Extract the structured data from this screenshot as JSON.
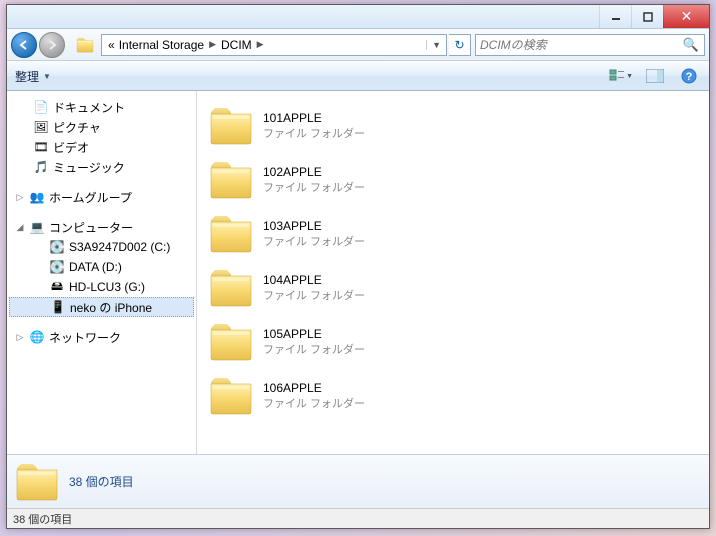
{
  "breadcrumb": {
    "root_marker": "«",
    "seg1": "Internal Storage",
    "seg2": "DCIM"
  },
  "search": {
    "placeholder": "DCIMの検索"
  },
  "toolbar": {
    "organize": "整理"
  },
  "tree": {
    "libraries": [
      {
        "label": "ドキュメント"
      },
      {
        "label": "ピクチャ"
      },
      {
        "label": "ビデオ"
      },
      {
        "label": "ミュージック"
      }
    ],
    "homegroup": "ホームグループ",
    "computer": "コンピューター",
    "drives": [
      {
        "label": "S3A9247D002 (C:)"
      },
      {
        "label": "DATA (D:)"
      },
      {
        "label": "HD-LCU3 (G:)"
      },
      {
        "label": "neko の iPhone"
      }
    ],
    "network": "ネットワーク"
  },
  "folder_type_label": "ファイル フォルダー",
  "items": [
    {
      "name": "101APPLE"
    },
    {
      "name": "102APPLE"
    },
    {
      "name": "103APPLE"
    },
    {
      "name": "104APPLE"
    },
    {
      "name": "105APPLE"
    },
    {
      "name": "106APPLE"
    }
  ],
  "details": {
    "summary": "38 個の項目"
  },
  "status": {
    "text": "38 個の項目"
  }
}
